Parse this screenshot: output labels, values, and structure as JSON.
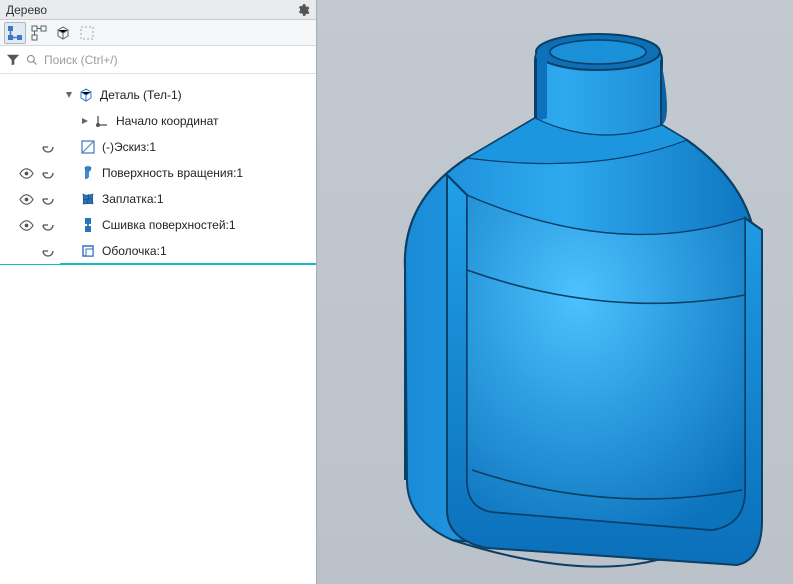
{
  "panel": {
    "title": "Дерево"
  },
  "search": {
    "placeholder": "Поиск (Ctrl+/)"
  },
  "tree": {
    "root": {
      "label": "Деталь (Тел-1)",
      "children": [
        {
          "label": "Начало координат"
        },
        {
          "label": "(-)Эскиз:1"
        },
        {
          "label": "Поверхность вращения:1"
        },
        {
          "label": "Заплатка:1"
        },
        {
          "label": "Сшивка поверхностей:1"
        },
        {
          "label": "Оболочка:1"
        }
      ]
    }
  }
}
